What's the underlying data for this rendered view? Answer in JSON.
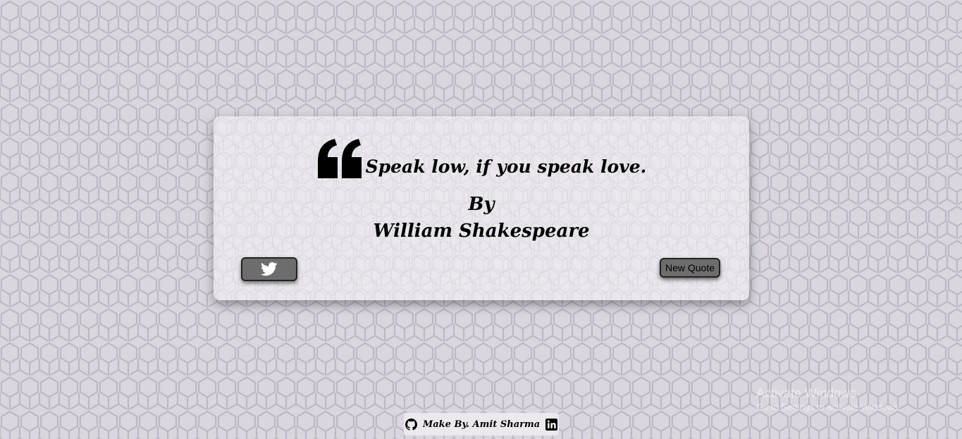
{
  "background": {
    "base_color": "#d9d6de",
    "hex_line_color": "#bdb9c4"
  },
  "quote_card": {
    "quote_icon": "left-double-quote-icon",
    "quote_text": "Speak low, if you speak love.",
    "by_label": "By",
    "author": "William Shakespeare",
    "tweet_button": {
      "icon": "twitter-bird-icon"
    },
    "new_quote_button": {
      "label": "New Quote",
      "color": "#6d6d6d"
    }
  },
  "footer": {
    "github_icon": "github-icon",
    "label": "Make By. Amit Sharma",
    "linkedin_icon": "linkedin-icon"
  },
  "os_watermark": {
    "title": "Activate Windows",
    "subtitle": "Go to Settings to activate Windows."
  }
}
